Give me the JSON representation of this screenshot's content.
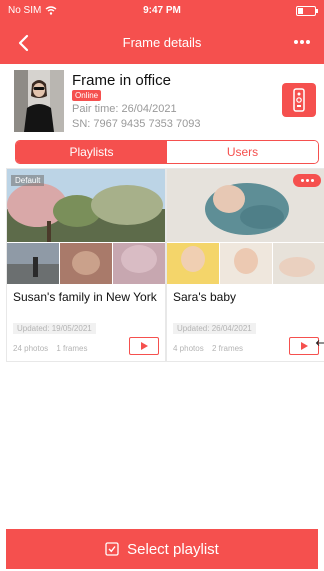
{
  "status_bar": {
    "carrier": "No SIM",
    "time": "9:47 PM"
  },
  "nav": {
    "title": "Frame details"
  },
  "frame": {
    "name": "Frame in office",
    "status": "Online",
    "pair_time": "Pair time: 26/04/2021",
    "serial": "SN: 7967 9435 7353 7093"
  },
  "tabs": [
    {
      "label": "Playlists",
      "active": true
    },
    {
      "label": "Users",
      "active": false
    }
  ],
  "playlists": [
    {
      "title": "Susan's family in New York",
      "tag": "Default",
      "updated": "Updated: 19/05/2021",
      "photos": "24 photos",
      "frames": "1 frames"
    },
    {
      "title": "Sara's baby",
      "updated": "Updated: 26/04/2021",
      "photos": "4 photos",
      "frames": "2 frames"
    }
  ],
  "footer": {
    "select_label": "Select playlist"
  },
  "colors": {
    "accent": "#f5504e"
  }
}
